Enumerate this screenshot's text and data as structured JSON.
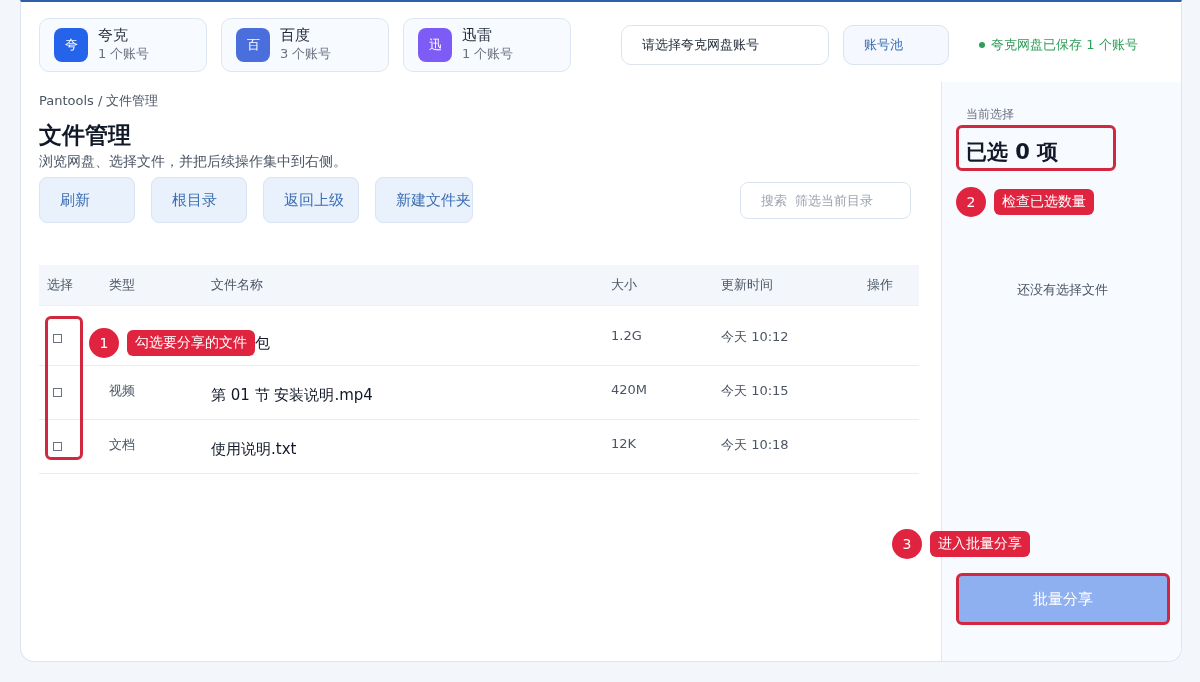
{
  "providers": [
    {
      "icon": "夸",
      "name": "夸克",
      "count": "1 个账号",
      "color": "#2563eb"
    },
    {
      "icon": "百",
      "name": "百度",
      "count": "3 个账号",
      "color": "#4a6fdc"
    },
    {
      "icon": "迅",
      "name": "迅雷",
      "count": "1 个账号",
      "color": "#7c5cf5"
    }
  ],
  "account_select": {
    "value": "请选择夸克网盘账号"
  },
  "account_pool_button": "账号池",
  "save_status": "夸克网盘已保存 1 个账号",
  "breadcrumb": "Pantools / 文件管理",
  "title": "文件管理",
  "subtitle": "浏览网盘、选择文件，并把后续操作集中到右侧。",
  "toolbar_buttons": [
    "刷新",
    "根目录",
    "返回上级",
    "新建文件夹"
  ],
  "search": {
    "placeholder": "搜索  筛选当前目录"
  },
  "table": {
    "columns": [
      "选择",
      "类型",
      "文件名称",
      "大小",
      "更新时间",
      "操作"
    ],
    "rows": [
      {
        "checked": false,
        "name": "包",
        "size": "1.2G",
        "updated": "今天 10:12"
      },
      {
        "checked": false,
        "type": "视频",
        "name": "第 01 节 安装说明.mp4",
        "size": "420M",
        "updated": "今天 10:15"
      },
      {
        "checked": false,
        "type": "文档",
        "name": "使用说明.txt",
        "size": "12K",
        "updated": "今天 10:18"
      }
    ]
  },
  "selection_panel": {
    "label": "当前选择",
    "count": "已选 0 项",
    "empty_text": "还没有选择文件",
    "batch_share_button": "批量分享"
  },
  "annotations": [
    {
      "number": "1",
      "text": "勾选要分享的文件"
    },
    {
      "number": "2",
      "text": "检查已选数量"
    },
    {
      "number": "3",
      "text": "进入批量分享"
    }
  ]
}
